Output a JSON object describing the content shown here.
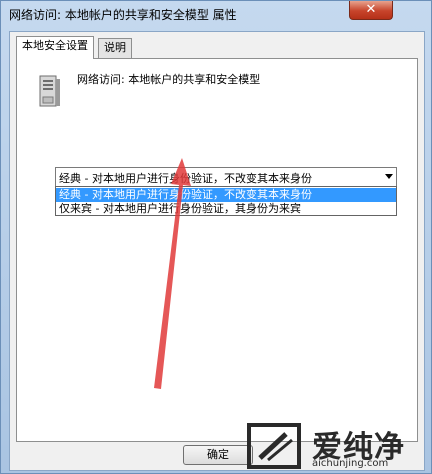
{
  "window": {
    "title": "网络访问: 本地帐户的共享和安全模型 属性",
    "close_glyph": "✕"
  },
  "tabs": [
    {
      "label": "本地安全设置",
      "active": true
    },
    {
      "label": "说明",
      "active": false
    }
  ],
  "policy": {
    "name": "网络访问: 本地帐户的共享和安全模型",
    "icon": "server-icon"
  },
  "select": {
    "value": "经典 - 对本地用户进行身份验证，不改变其本来身份",
    "options": [
      {
        "label": "经典 - 对本地用户进行身份验证，不改变其本来身份",
        "highlighted": true
      },
      {
        "label": "仅来宾 - 对本地用户进行身份验证，其身份为来宾",
        "highlighted": false
      }
    ]
  },
  "buttons": {
    "ok_label": "确定"
  },
  "watermark": {
    "text": "爱纯净",
    "url": "aichunjing.com"
  },
  "colors": {
    "highlight": "#3399ff",
    "arrow": "#e03a3a",
    "close": "#c7442b"
  }
}
